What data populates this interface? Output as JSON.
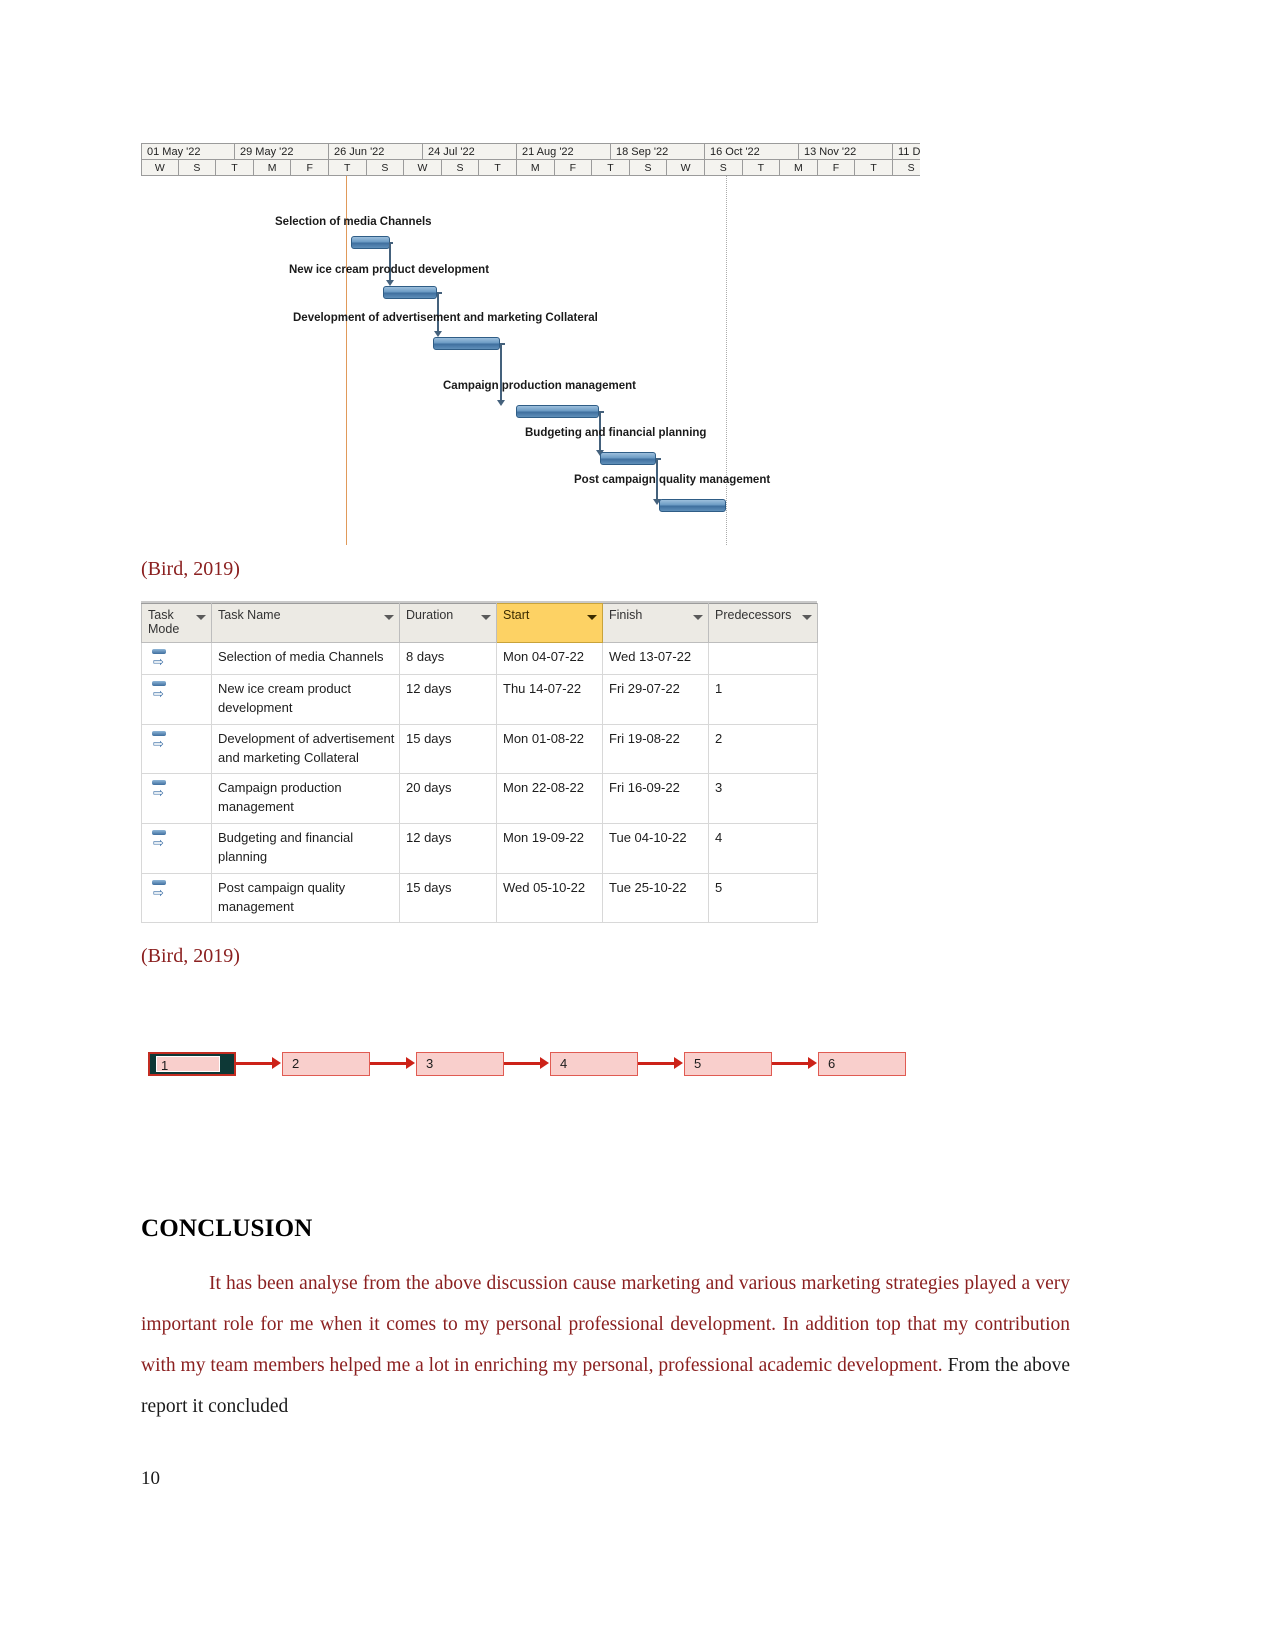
{
  "gantt": {
    "timeline_months": [
      "01 May '22",
      "29 May '22",
      "26 Jun '22",
      "24 Jul '22",
      "21 Aug '22",
      "18 Sep '22",
      "16 Oct '22",
      "13 Nov '22",
      "11 De"
    ],
    "timeline_days": [
      "W",
      "S",
      "T",
      "M",
      "F",
      "T",
      "S",
      "W",
      "S",
      "T",
      "M",
      "F",
      "T",
      "S",
      "W",
      "S",
      "T",
      "M",
      "F",
      "T",
      "S"
    ],
    "tasks": [
      {
        "label": "Selection of media Channels"
      },
      {
        "label": "New ice cream product development"
      },
      {
        "label": "Development of advertisement and marketing Collateral"
      },
      {
        "label": "Campaign production management"
      },
      {
        "label": "Budgeting and financial planning"
      },
      {
        "label": "Post campaign quality management"
      }
    ]
  },
  "citation_one": "(Bird, 2019)",
  "citation_two": "(Bird, 2019)",
  "table": {
    "headers": {
      "task_mode": "Task Mode",
      "task_name": "Task Name",
      "duration": "Duration",
      "start": "Start",
      "finish": "Finish",
      "predecessors": "Predecessors"
    },
    "rows": [
      {
        "name": "Selection of media Channels",
        "duration": "8 days",
        "start": "Mon 04-07-22",
        "finish": "Wed 13-07-22",
        "pred": ""
      },
      {
        "name": "New ice cream product development",
        "duration": "12 days",
        "start": "Thu 14-07-22",
        "finish": "Fri 29-07-22",
        "pred": "1"
      },
      {
        "name": "Development of advertisement and marketing Collateral",
        "duration": "15 days",
        "start": "Mon 01-08-22",
        "finish": "Fri 19-08-22",
        "pred": "2"
      },
      {
        "name": "Campaign production management",
        "duration": "20 days",
        "start": "Mon 22-08-22",
        "finish": "Fri 16-09-22",
        "pred": "3"
      },
      {
        "name": "Budgeting and financial planning",
        "duration": "12 days",
        "start": "Mon 19-09-22",
        "finish": "Tue 04-10-22",
        "pred": "4"
      },
      {
        "name": "Post campaign quality management",
        "duration": "15 days",
        "start": "Wed 05-10-22",
        "finish": "Tue 25-10-22",
        "pred": "5"
      }
    ]
  },
  "network": {
    "nodes": [
      "1",
      "2",
      "3",
      "4",
      "5",
      "6"
    ]
  },
  "conclusion": {
    "heading": "CONCLUSION",
    "body_red": "It has been analyse from the above discussion cause marketing and various marketing strategies played a very important role for me when it comes to my personal professional development. In addition top that my contribution with my team members helped me a lot in enriching my personal, professional academic development. ",
    "body_black": " From the above report it concluded"
  },
  "page_number": "10",
  "colors": {
    "text_red": "#8b2020",
    "bar_blue": "#3f6f9e",
    "node_fill": "#f9cfcc",
    "node_border": "#e05b52",
    "arrow_red": "#cc2218",
    "header_highlight": "#fdd264"
  }
}
